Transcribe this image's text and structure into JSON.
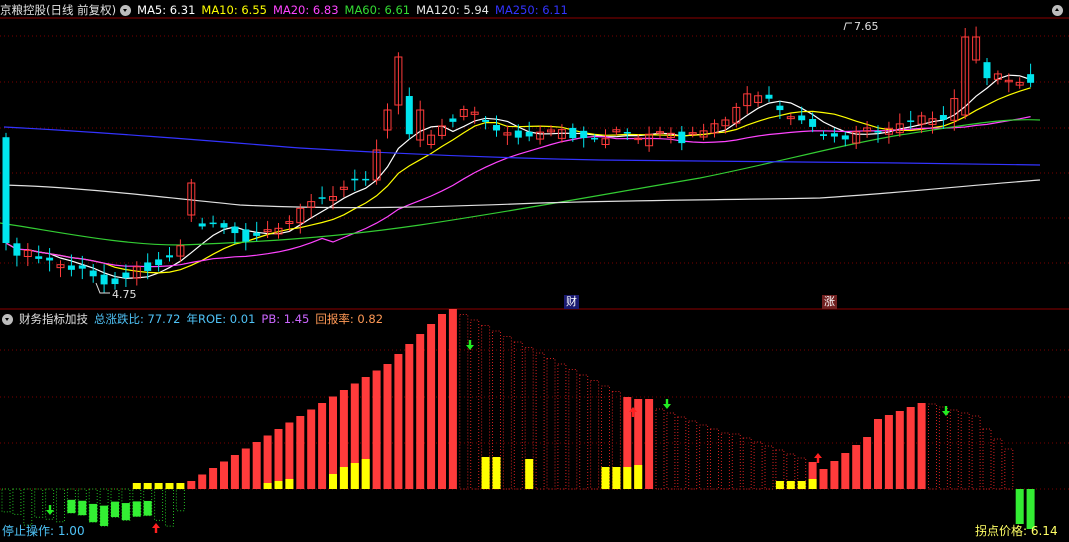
{
  "main_panel": {
    "stock_name": "京粮控股",
    "period": "(日线 前复权)",
    "ma_items": [
      {
        "label": "MA5: 6.31",
        "color": "#ffffff"
      },
      {
        "label": "MA10: 6.55",
        "color": "#ffff00"
      },
      {
        "label": "MA20: 6.83",
        "color": "#ff44ff"
      },
      {
        "label": "MA60: 6.61",
        "color": "#33dd33"
      },
      {
        "label": "MA120: 5.94",
        "color": "#e6e6e6"
      },
      {
        "label": "MA250: 6.11",
        "color": "#3333ff"
      }
    ],
    "high_label": "7.65",
    "low_label": "4.75",
    "event_tags": [
      {
        "label": "财",
        "color": "#4d86ff"
      },
      {
        "label": "涨",
        "color": "#ff3b3b"
      }
    ]
  },
  "indicator_panel": {
    "name": "财务指标加技",
    "items": [
      {
        "label": "总涨跌比: 77.72",
        "color": "#4fc3f7"
      },
      {
        "label": "年ROE: 0.01",
        "color": "#4fc3f7"
      },
      {
        "label": "PB: 1.45",
        "color": "#cc66ff"
      },
      {
        "label": "回报率: 0.82",
        "color": "#ff9955"
      }
    ],
    "stop_label": "停止操作: 1.00",
    "pivot_label": "拐点价格: 6.14"
  },
  "colors": {
    "up": "#ff3b3b",
    "down": "#00e5ee",
    "grid": "#7a0000",
    "dot_red": "#d02020",
    "dot_green": "#22bb22",
    "bar_yellow": "#ffff00",
    "bar_green": "#33ee33",
    "arrow_red": "#ff2020",
    "arrow_green": "#22ee22"
  },
  "icons": {
    "mode_button": "dropdown-circle-icon",
    "corner_button": "collapse-circle-icon"
  }
}
